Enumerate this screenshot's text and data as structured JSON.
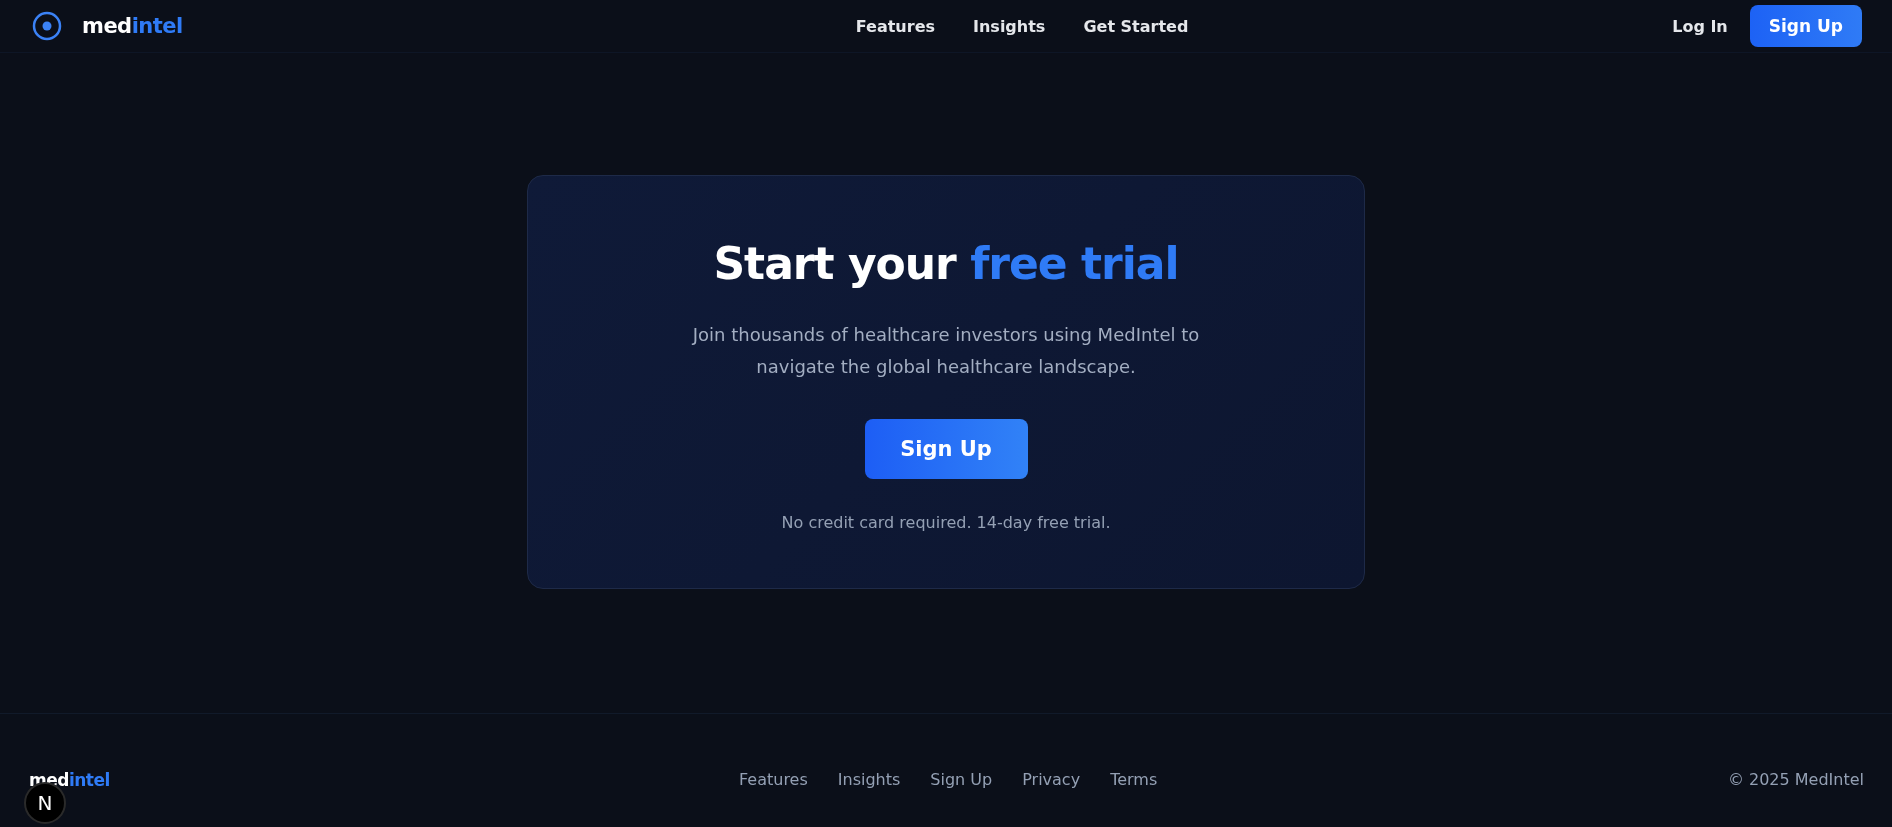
{
  "header": {
    "logo": {
      "part1": "med",
      "part2": "intel"
    },
    "nav": [
      {
        "label": "Features"
      },
      {
        "label": "Insights"
      },
      {
        "label": "Get Started"
      }
    ],
    "login": "Log In",
    "signup": "Sign Up"
  },
  "cta": {
    "title": "Start your",
    "title_accent": "free trial",
    "text": "Join thousands of healthcare investors using MedIntel to navigate the global healthcare landscape.",
    "button": "Sign Up",
    "note": "No credit card required. 14-day free trial."
  },
  "footer": {
    "logo": {
      "part1": "med",
      "part2": "intel"
    },
    "links": [
      {
        "label": "Features"
      },
      {
        "label": "Insights"
      },
      {
        "label": "Sign Up"
      },
      {
        "label": "Privacy"
      },
      {
        "label": "Terms"
      }
    ],
    "copyright": "© 2025 MedIntel"
  },
  "dev_badge": "N"
}
